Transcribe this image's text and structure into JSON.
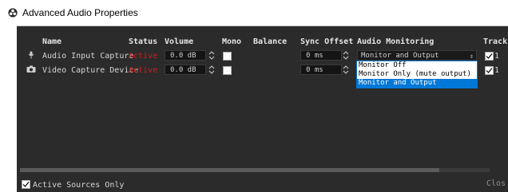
{
  "window": {
    "title": "Advanced Audio Properties"
  },
  "table": {
    "headers": [
      "Name",
      "Status",
      "Volume",
      "Mono",
      "Balance",
      "Sync Offset",
      "Audio Monitoring",
      "Track"
    ],
    "rows": [
      {
        "name": "Audio Input Capture",
        "status": "Active",
        "volume": "0.0 dB",
        "sync_offset": "0 ms",
        "monitoring": "Monitor and Output",
        "mono": false,
        "track_checked": true,
        "track_label": "1"
      },
      {
        "name": "Video Capture Device",
        "status": "Active",
        "volume": "0.0 dB",
        "sync_offset": "0 ms",
        "monitoring": "Monitor and Output",
        "mono": false,
        "track_checked": true,
        "track_label": "1"
      }
    ]
  },
  "dropdown": {
    "options": [
      "Monitor Off",
      "Monitor Only (mute output)",
      "Monitor and Output"
    ],
    "selected_index": 2
  },
  "footer": {
    "active_sources_only_label": "Active Sources Only",
    "active_sources_only_checked": true,
    "close_label": "Clos"
  },
  "colors": {
    "background": "#2b2b2b",
    "status_active": "#d21b1b",
    "accent": "#0078d7"
  },
  "icons": {
    "app": "obs-logo-icon",
    "row1": "microphone-icon",
    "row2": "camera-icon"
  }
}
